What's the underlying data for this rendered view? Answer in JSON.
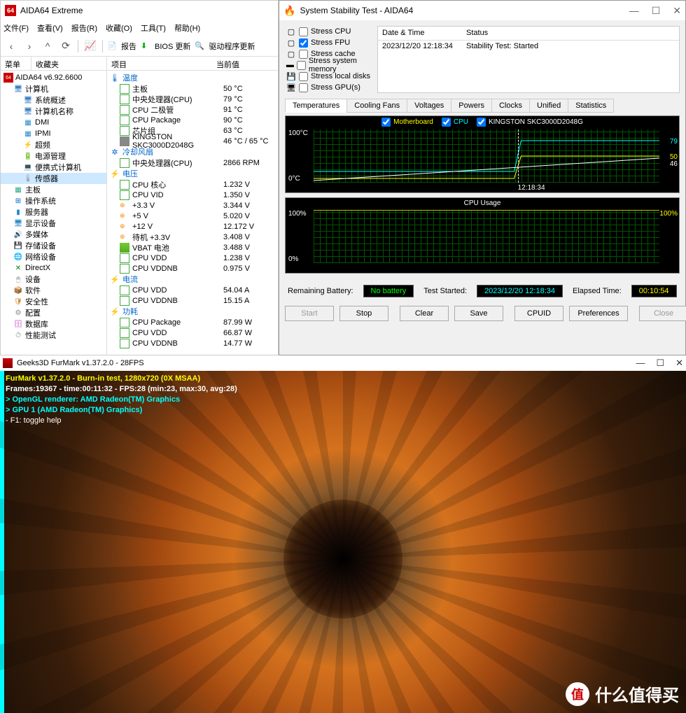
{
  "aida": {
    "title": "AIDA64 Extreme",
    "menu": [
      "文件(F)",
      "查看(V)",
      "报告(R)",
      "收藏(O)",
      "工具(T)",
      "帮助(H)"
    ],
    "toolbar": {
      "report": "报告",
      "bios": "BIOS 更新",
      "driver": "驱动程序更新"
    },
    "sidebar_hdr": {
      "menu": "菜单",
      "fav": "收藏夹"
    },
    "tree_root": "AIDA64 v6.92.6600",
    "tree": {
      "computer": "计算机",
      "items_l2": [
        "系统概述",
        "计算机名称",
        "DMI",
        "IPMI",
        "超频",
        "电源管理",
        "便携式计算机",
        "传感器"
      ],
      "items_l1": [
        "主板",
        "操作系统",
        "服务器",
        "显示设备",
        "多媒体",
        "存储设备",
        "网络设备",
        "DirectX",
        "设备",
        "软件",
        "安全性",
        "配置",
        "数据库",
        "性能测试"
      ]
    },
    "content_hdr": {
      "item": "项目",
      "current": "当前值"
    },
    "groups": {
      "temp": {
        "label": "温度",
        "rows": [
          {
            "n": "主板",
            "v": "50 °C"
          },
          {
            "n": "中央处理器(CPU)",
            "v": "79 °C"
          },
          {
            "n": "CPU 二极管",
            "v": "91 °C"
          },
          {
            "n": "CPU Package",
            "v": "90 °C"
          },
          {
            "n": "芯片组",
            "v": "63 °C"
          },
          {
            "n": "KINGSTON SKC3000D2048G",
            "v": "46 °C / 65 °C",
            "hdd": true
          }
        ]
      },
      "fan": {
        "label": "冷却风扇",
        "rows": [
          {
            "n": "中央处理器(CPU)",
            "v": "2866 RPM"
          }
        ]
      },
      "volt": {
        "label": "电压",
        "rows": [
          {
            "n": "CPU 核心",
            "v": "1.232 V"
          },
          {
            "n": "CPU VID",
            "v": "1.350 V"
          },
          {
            "n": "+3.3 V",
            "v": "3.344 V",
            "volt": true
          },
          {
            "n": "+5 V",
            "v": "5.020 V",
            "volt": true
          },
          {
            "n": "+12 V",
            "v": "12.172 V",
            "volt": true
          },
          {
            "n": "待机 +3.3V",
            "v": "3.408 V",
            "volt": true
          },
          {
            "n": "VBAT 电池",
            "v": "3.488 V",
            "vbat": true
          },
          {
            "n": "CPU VDD",
            "v": "1.238 V"
          },
          {
            "n": "CPU VDDNB",
            "v": "0.975 V"
          }
        ]
      },
      "amp": {
        "label": "电流",
        "rows": [
          {
            "n": "CPU VDD",
            "v": "54.04 A"
          },
          {
            "n": "CPU VDDNB",
            "v": "15.15 A"
          }
        ]
      },
      "pwr": {
        "label": "功耗",
        "rows": [
          {
            "n": "CPU Package",
            "v": "87.99 W"
          },
          {
            "n": "CPU VDD",
            "v": "66.87 W"
          },
          {
            "n": "CPU VDDNB",
            "v": "14.77 W"
          }
        ]
      }
    }
  },
  "sst": {
    "title": "System Stability Test - AIDA64",
    "checks": [
      {
        "l": "Stress CPU",
        "c": false
      },
      {
        "l": "Stress FPU",
        "c": true
      },
      {
        "l": "Stress cache",
        "c": false
      },
      {
        "l": "Stress system memory",
        "c": false
      },
      {
        "l": "Stress local disks",
        "c": false
      },
      {
        "l": "Stress GPU(s)",
        "c": false
      }
    ],
    "status_hdr": {
      "dt": "Date & Time",
      "st": "Status"
    },
    "status_row": {
      "dt": "2023/12/20 12:18:34",
      "st": "Stability Test: Started"
    },
    "tabs": [
      "Temperatures",
      "Cooling Fans",
      "Voltages",
      "Powers",
      "Clocks",
      "Unified",
      "Statistics"
    ],
    "chart1": {
      "legend": [
        {
          "n": "Motherboard",
          "c": "#ffff00"
        },
        {
          "n": "CPU",
          "c": "#00ffff"
        },
        {
          "n": "KINGSTON SKC3000D2048G",
          "c": "#ffffff"
        }
      ],
      "ymax": "100°C",
      "ymin": "0°C",
      "xlab": "12:18:34",
      "r1": "79",
      "r2": "50",
      "r3": "46"
    },
    "chart2": {
      "title": "CPU Usage",
      "ymax": "100%",
      "ymin": "0%",
      "rmax": "100%"
    },
    "info": {
      "rb_l": "Remaining Battery:",
      "rb_v": "No battery",
      "ts_l": "Test Started:",
      "ts_v": "2023/12/20 12:18:34",
      "et_l": "Elapsed Time:",
      "et_v": "00:10:54"
    },
    "btns": {
      "start": "Start",
      "stop": "Stop",
      "clear": "Clear",
      "save": "Save",
      "cpuid": "CPUID",
      "pref": "Preferences",
      "close": "Close"
    }
  },
  "furmark": {
    "title": "Geeks3D FurMark v1.37.2.0 - 28FPS",
    "l1": "FurMark v1.37.2.0 - Burn-in test, 1280x720 (0X MSAA)",
    "l2": "Frames:19367 - time:00:11:32 - FPS:28 (min:23, max:30, avg:28)",
    "l3": "> OpenGL renderer: AMD Radeon(TM) Graphics",
    "l4": "> GPU 1 (AMD Radeon(TM) Graphics)",
    "l5": "- F1: toggle help"
  },
  "watermark": "什么值得买",
  "chart_data": [
    {
      "type": "line",
      "title": "Temperatures",
      "ylabel": "°C",
      "ylim": [
        0,
        100
      ],
      "x_time_marker": "12:18:34",
      "series": [
        {
          "name": "Motherboard",
          "current": 50,
          "color": "#ffff00"
        },
        {
          "name": "CPU",
          "current": 79,
          "color": "#00ffff"
        },
        {
          "name": "KINGSTON SKC3000D2048G",
          "current": 46,
          "color": "#ffffff"
        }
      ]
    },
    {
      "type": "line",
      "title": "CPU Usage",
      "ylabel": "%",
      "ylim": [
        0,
        100
      ],
      "series": [
        {
          "name": "CPU Usage",
          "current": 100,
          "color": "#ffff00"
        }
      ]
    }
  ]
}
